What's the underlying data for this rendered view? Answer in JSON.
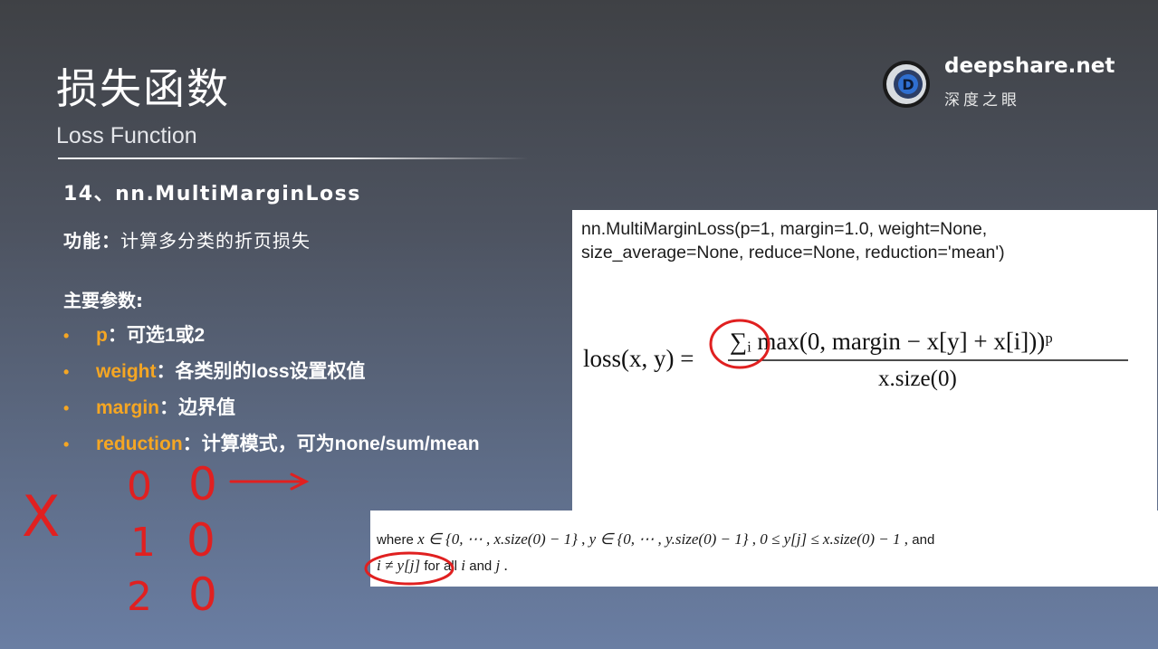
{
  "slide": {
    "title": "损失函数",
    "subtitle": "Loss Function"
  },
  "brand": {
    "name": "deepshare.net",
    "cn_name": "深度之眼",
    "logo_letter": "D",
    "logo_icon": "eye-logo-icon"
  },
  "section": {
    "heading": "14、nn.MultiMarginLoss",
    "function_label": "功能：",
    "function_text": "计算多分类的折页损失",
    "params_heading": "主要参数:"
  },
  "params": [
    {
      "bullet": "•",
      "name": "p",
      "sep": "：",
      "desc": "可选1或2"
    },
    {
      "bullet": "•",
      "name": "weight",
      "sep": "：",
      "desc": "各类别的loss设置权值"
    },
    {
      "bullet": "•",
      "name": "margin",
      "sep": "：",
      "desc": "边界值"
    },
    {
      "bullet": "•",
      "name": "reduction",
      "sep": "：",
      "desc": "计算模式，可为none/sum/mean"
    }
  ],
  "code": {
    "line1": "nn.MultiMarginLoss(p=1, margin=1.0, weight=None,",
    "line2": "size_average=None, reduce=None, reduction='mean')"
  },
  "formula": {
    "lhs": "loss(x, y) =",
    "numerator": "∑ᵢ max(0, margin − x[y] + x[i]))ᵖ",
    "denominator": "x.size(0)"
  },
  "where": {
    "w1": "where",
    "m1": "x ∈ {0, ⋯ , x.size(0) − 1}",
    "m2": "y ∈ {0, ⋯ , y.size(0) − 1}",
    "m3": "0 ≤ y[j] ≤ x.size(0) − 1",
    "and1": "and",
    "m4": "i ≠ y[j]",
    "w2": "for all",
    "m5": "i",
    "and2": "and",
    "m6": "j"
  },
  "annotations": {
    "x_label": "X",
    "rows": [
      {
        "index": "0",
        "value": "0"
      },
      {
        "index": "1",
        "value": "0"
      },
      {
        "index": "2",
        "value": "0"
      }
    ]
  },
  "colors": {
    "accent": "#f5a623",
    "ink": "#e02020"
  }
}
